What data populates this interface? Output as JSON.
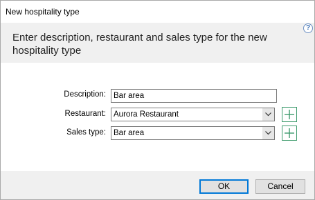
{
  "window": {
    "title": "New hospitality type"
  },
  "header": {
    "text": "Enter description, restaurant and sales type for the new hospitality type",
    "help_icon": "question-mark",
    "help_glyph": "?"
  },
  "form": {
    "description": {
      "label": "Description:",
      "value": "Bar area"
    },
    "restaurant": {
      "label": "Restaurant:",
      "value": "Aurora Restaurant"
    },
    "sales_type": {
      "label": "Sales type:",
      "value": "Bar area"
    }
  },
  "buttons": {
    "ok_label": "OK",
    "cancel_label": "Cancel"
  },
  "colors": {
    "accent": "#0078d7",
    "add_button_green": "#3c9a6b"
  }
}
